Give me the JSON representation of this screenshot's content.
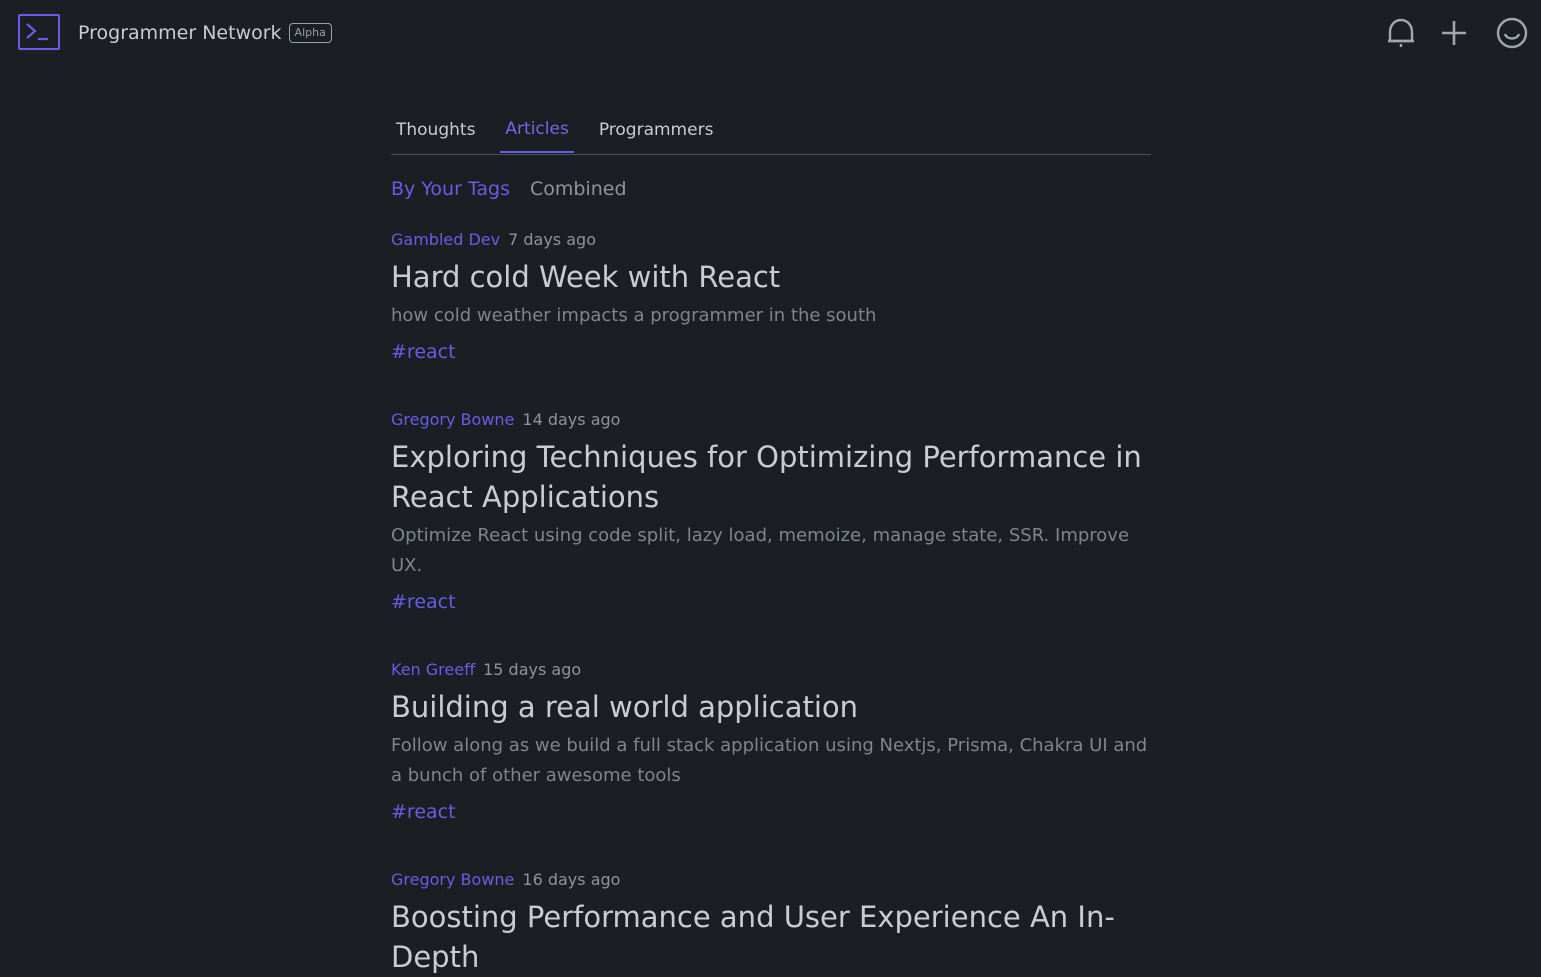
{
  "header": {
    "brand": "Programmer Network",
    "badge": "Alpha",
    "icons": [
      "bell-icon",
      "plus-icon",
      "smiley-icon"
    ]
  },
  "tabs": [
    {
      "label": "Thoughts",
      "active": false
    },
    {
      "label": "Articles",
      "active": true
    },
    {
      "label": "Programmers",
      "active": false
    }
  ],
  "filters": [
    {
      "label": "By Your Tags",
      "active": true
    },
    {
      "label": "Combined",
      "active": false
    }
  ],
  "articles": [
    {
      "author": "Gambled Dev",
      "time": "7 days ago",
      "title": "Hard cold Week with React",
      "description": "how cold weather impacts a programmer in the south",
      "tag": "#react"
    },
    {
      "author": "Gregory Bowne",
      "time": "14 days ago",
      "title": "Exploring Techniques for Optimizing Performance in React Applications",
      "description": "Optimize React using code split, lazy load, memoize, manage state, SSR. Improve UX.",
      "tag": "#react"
    },
    {
      "author": "Ken Greeff",
      "time": "15 days ago",
      "title": "Building a real world application",
      "description": "Follow along as we build a full stack application using Nextjs, Prisma, Chakra UI and a bunch of other awesome tools",
      "tag": "#react"
    },
    {
      "author": "Gregory Bowne",
      "time": "16 days ago",
      "title": "Boosting Performance and User Experience An In-Depth"
    }
  ],
  "colors": {
    "background": "#1b1e23",
    "accent": "#6a5ce6",
    "text": "#c9cdd3",
    "muted": "#80858c"
  }
}
